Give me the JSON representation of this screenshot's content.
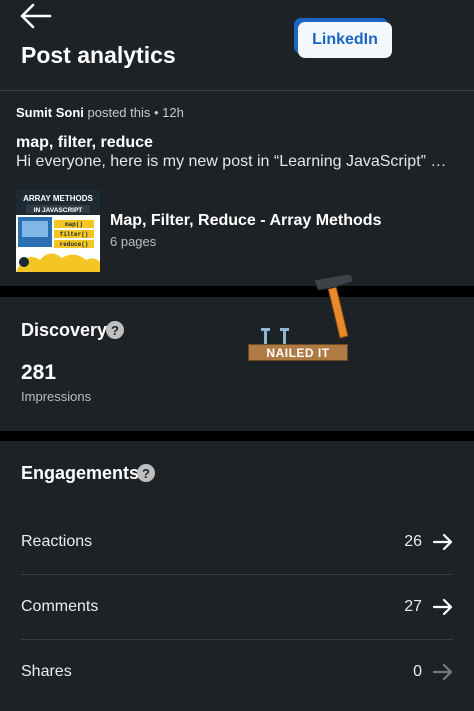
{
  "header": {
    "title": "Post analytics",
    "badge": "LinkedIn"
  },
  "post": {
    "author": "Sumit Soni",
    "meta_suffix": " posted this • 12h",
    "title": "map, filter, reduce",
    "text": "Hi everyone, here is my new post in “Learning JavaScript” …",
    "document": {
      "title": "Map, Filter, Reduce - Array Methods",
      "pages": "6 pages",
      "thumb_title_line1": "ARRAY METHODS",
      "thumb_title_line2": "IN JAVASCRIPT",
      "thumb_tags": [
        "map()",
        "filter()",
        "reduce()"
      ]
    }
  },
  "discovery": {
    "title": "Discovery",
    "impressions_value": "281",
    "impressions_label": "Impressions"
  },
  "sticker": {
    "text": "NAILED IT"
  },
  "engagements": {
    "title": "Engagements",
    "rows": [
      {
        "label": "Reactions",
        "count": "26"
      },
      {
        "label": "Comments",
        "count": "27"
      },
      {
        "label": "Shares",
        "count": "0"
      }
    ]
  },
  "colors": {
    "panel": "#1d2226",
    "gap": "#000000",
    "linkedin_blue": "#1967c2",
    "arrow_active": "#ffffff",
    "arrow_disabled": "#7a7a7a"
  }
}
